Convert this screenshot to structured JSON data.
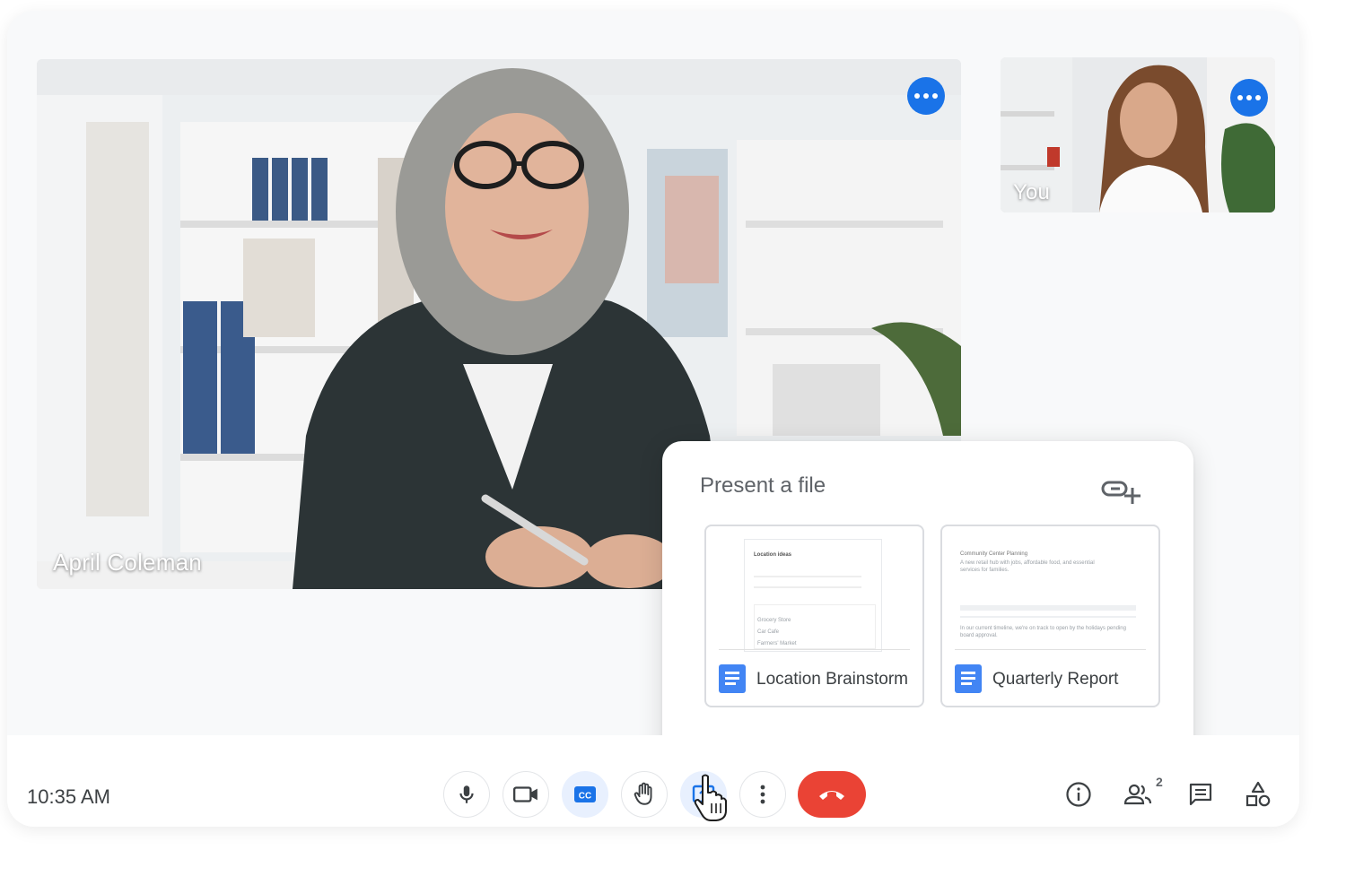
{
  "main_video": {
    "participant_name": "April Coleman",
    "more_icon": "more-horiz-icon"
  },
  "self_video": {
    "participant_name": "You",
    "more_icon": "more-horiz-icon"
  },
  "present_panel": {
    "title": "Present a file",
    "add_link_icon": "add-link-icon",
    "files": [
      {
        "name": "Location Brainstorm",
        "icon": "google-docs-icon",
        "thumb_heading": "Location ideas",
        "thumb_rows": [
          "Grocery Store",
          "Car Cafe",
          "Farmers' Market"
        ]
      },
      {
        "name": "Quarterly Report",
        "icon": "google-docs-icon",
        "thumb_heading": "Community Center Planning",
        "thumb_subtitle": "A new retail hub with jobs, affordable food, and essential services for families.",
        "thumb_note": "In our current timeline, we're on track to open by the holidays pending board approval."
      }
    ]
  },
  "toolbar": {
    "time": "10:35 AM",
    "controls": [
      {
        "name": "microphone",
        "icon": "mic-icon"
      },
      {
        "name": "camera",
        "icon": "videocam-icon"
      },
      {
        "name": "captions",
        "icon": "closed-caption-icon",
        "label": "CC",
        "active": true
      },
      {
        "name": "raise-hand",
        "icon": "hand-icon"
      },
      {
        "name": "present",
        "icon": "present-screen-icon",
        "active": true
      },
      {
        "name": "more-options",
        "icon": "more-vert-icon"
      },
      {
        "name": "leave-call",
        "icon": "call-end-icon"
      }
    ],
    "side": [
      {
        "name": "meeting-details",
        "icon": "info-icon"
      },
      {
        "name": "people",
        "icon": "people-icon",
        "badge": "2"
      },
      {
        "name": "chat",
        "icon": "chat-icon"
      },
      {
        "name": "activities",
        "icon": "shapes-icon"
      }
    ]
  },
  "colors": {
    "accent": "#1a73e8",
    "end_call": "#ea4335",
    "docs": "#4285f4",
    "active_bg": "#e8f0fe"
  }
}
